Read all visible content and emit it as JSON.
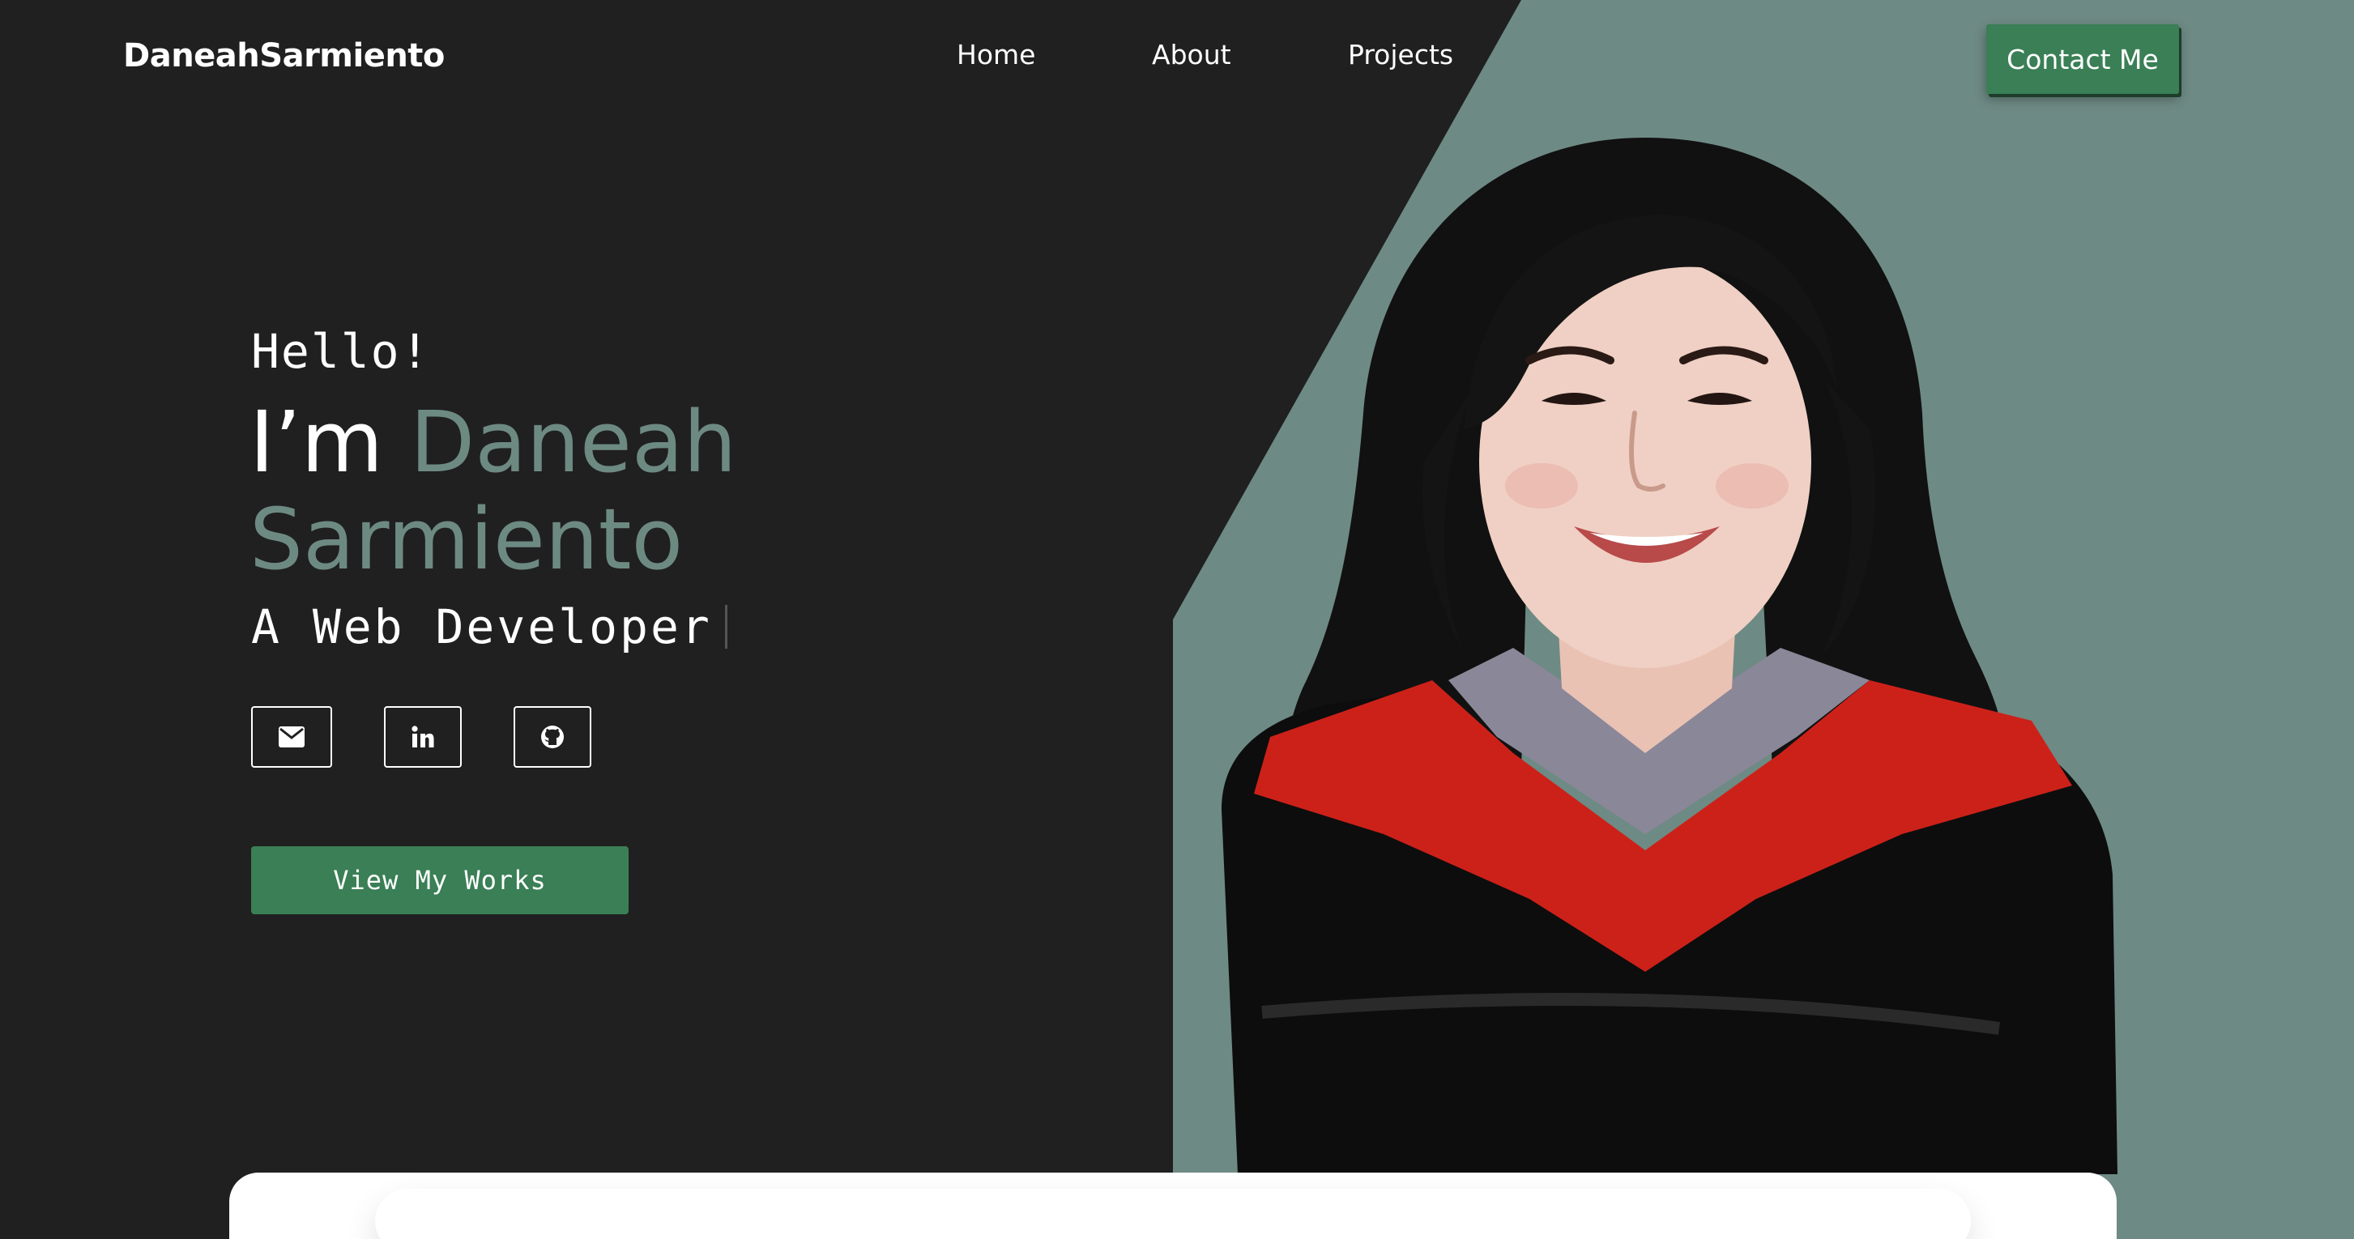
{
  "brand": "DaneahSarmiento",
  "nav": {
    "home": "Home",
    "about": "About",
    "projects": "Projects"
  },
  "contact_label": "Contact Me",
  "hero": {
    "greeting": "Hello!",
    "intro": "I’m ",
    "first_name": "Daneah",
    "last_name": "Sarmiento",
    "role": "A Web Developer"
  },
  "social": [
    {
      "icon": "envelope-icon"
    },
    {
      "icon": "linkedin-icon"
    },
    {
      "icon": "github-icon"
    }
  ],
  "cta_label": "View My Works",
  "colors": {
    "background": "#202020",
    "accent_panel": "#6e8a84",
    "name_accent": "#6d8a82",
    "button_green": "#3a7f56",
    "toga_red": "#cc2119",
    "hood_gray": "#8a8798",
    "toga_black": "#0c0c0c"
  }
}
